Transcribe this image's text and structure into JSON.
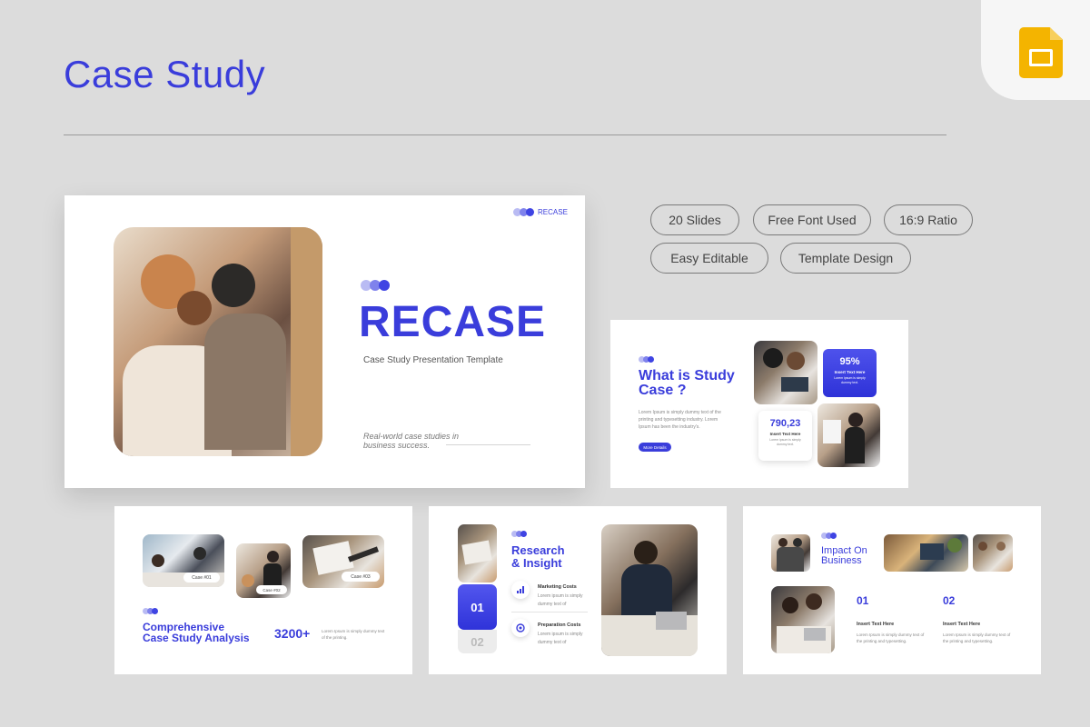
{
  "page": {
    "title": "Case Study"
  },
  "badges": [
    "20 Slides",
    "Free Font Used",
    "16:9 Ratio",
    "Easy Editable",
    "Template Design"
  ],
  "main_slide": {
    "logo": "RECASE",
    "heading": "RECASE",
    "subtitle": "Case Study Presentation Template",
    "tagline_line1": "Real-world case studies in",
    "tagline_line2": "business success."
  },
  "slide2": {
    "heading_line1": "What is Study",
    "heading_line2": "Case ?",
    "body": "Lorem Ipsum is simply dummy text of the printing and typesetting industry. Lorem Ipsum has been the industry's.",
    "button": "More Details",
    "stat1_value": "95%",
    "stat1_label": "Insert Text Here",
    "stat1_desc": "Lorem ipsum is simply dummy text.",
    "stat2_value": "790,23",
    "stat2_label": "Insert Text Here",
    "stat2_desc": "Lorem ipsum is simply dummy text."
  },
  "slide3": {
    "case1": "Case #01",
    "case2": "Case #02",
    "case3": "Case #03",
    "heading_line1": "Comprehensive",
    "heading_line2": "Case Study Analysis",
    "stat": "3200+",
    "desc": "Lorem Ipsum is simply dummy text of the printing."
  },
  "slide4": {
    "heading_line1": "Research",
    "heading_line2": "& Insight",
    "num1": "01",
    "num2": "02",
    "item1_title": "Marketing Costs",
    "item1_desc": "Lorem ipsum is simply dummy text of",
    "item2_title": "Preparation Costs",
    "item2_desc": "Lorem ipsum is simply dummy text of"
  },
  "slide5": {
    "heading_line1": "Impact On",
    "heading_line2": "Business",
    "num1": "01",
    "num2": "02",
    "label1": "Insert Text Here",
    "label2": "Insert Text Here",
    "desc1": "Lorem Ipsum is simply dummy text of the printing and typesetting.",
    "desc2": "Lorem Ipsum is simply dummy text of the printing and typesetting."
  },
  "colors": {
    "accent": "#3a3ddb",
    "background": "#dcdcdc",
    "google_slides": "#f4b400"
  },
  "icons": [
    "google-slides-icon",
    "chart-icon",
    "target-icon"
  ]
}
